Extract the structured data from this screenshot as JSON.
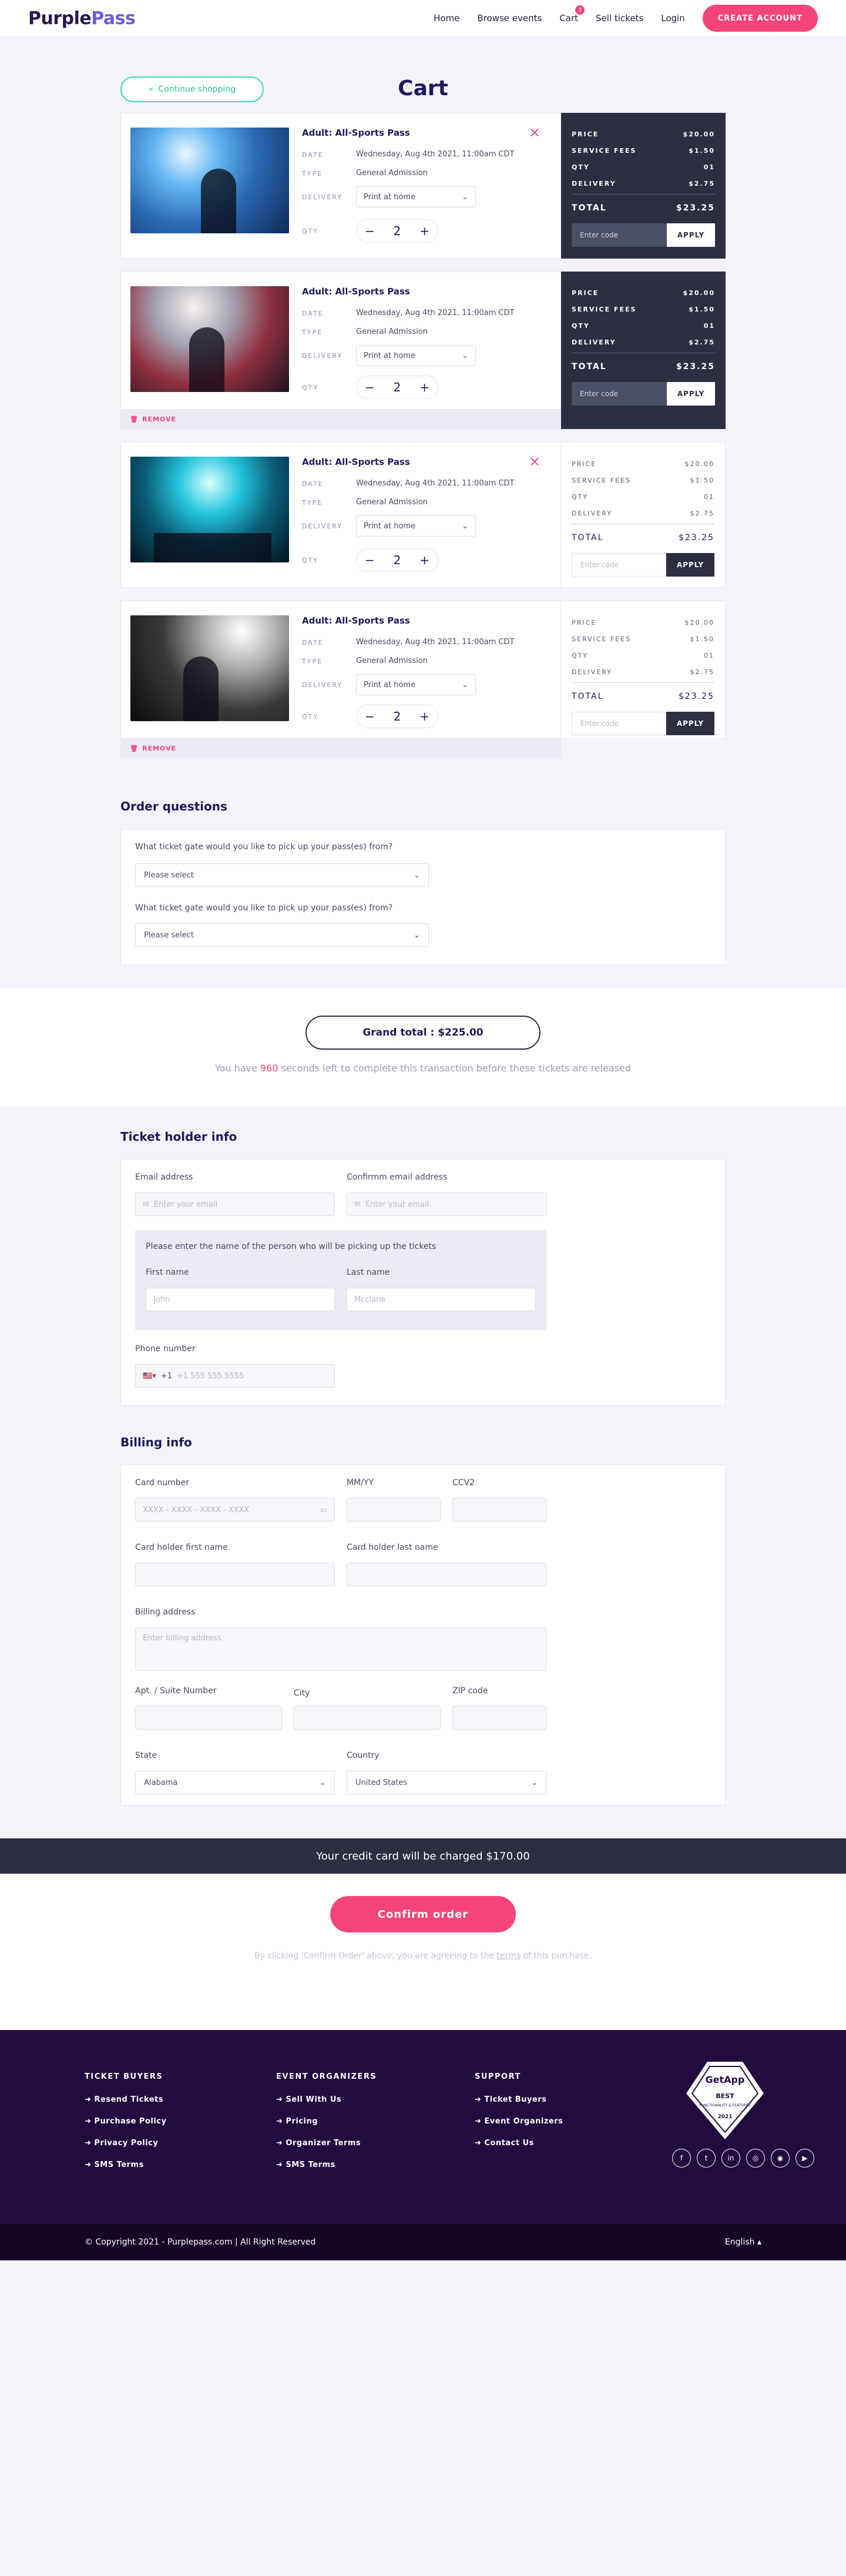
{
  "header": {
    "logo_a": "Purple",
    "logo_b": "Pass",
    "nav": [
      "Home",
      "Browse events",
      "Cart",
      "Sell tickets",
      "Login"
    ],
    "cart_count": "3",
    "create_account": "CREATE ACCOUNT"
  },
  "cart": {
    "continue": "Continue shopping",
    "title": "Cart",
    "labels": {
      "date": "DATE",
      "type": "TYPE",
      "delivery": "DELIVERY",
      "qty": "QTY",
      "remove": "REMOVE"
    },
    "price_labels": {
      "price": "PRICE",
      "fees": "SERVICE FEES",
      "qty": "QTY",
      "delivery": "DELIVERY",
      "total": "TOTAL"
    },
    "promo_placeholder": "Enter code",
    "apply": "APPLY",
    "items": [
      {
        "name": "Adult: All-Sports Pass",
        "date": "Wednesday, Aug 4th 2021, 11:00am CDT",
        "type": "General Admission",
        "delivery": "Print at home",
        "qty": "2",
        "price": "$20.00",
        "fees": "$1.50",
        "pqty": "01",
        "pdelivery": "$2.75",
        "total": "$23.25"
      },
      {
        "name": "Adult: All-Sports Pass",
        "date": "Wednesday, Aug 4th 2021, 11:00am CDT",
        "type": "General Admission",
        "delivery": "Print at home",
        "qty": "2",
        "price": "$20.00",
        "fees": "$1.50",
        "pqty": "01",
        "pdelivery": "$2.75",
        "total": "$23.25"
      },
      {
        "name": "Adult: All-Sports Pass",
        "date": "Wednesday, Aug 4th 2021, 11:00am CDT",
        "type": "General Admission",
        "delivery": "Print at home",
        "qty": "2",
        "price": "$20.00",
        "fees": "$1.50",
        "pqty": "01",
        "pdelivery": "$2.75",
        "total": "$23.25"
      },
      {
        "name": "Adult: All-Sports Pass",
        "date": "Wednesday, Aug 4th 2021, 11:00am CDT",
        "type": "General Admission",
        "delivery": "Print at home",
        "qty": "2",
        "price": "$20.00",
        "fees": "$1.50",
        "pqty": "01",
        "pdelivery": "$2.75",
        "total": "$23.25"
      }
    ]
  },
  "questions": {
    "title": "Order questions",
    "q1": "What ticket gate would you like to pick up your pass(es) from?",
    "q2": "What ticket gate would you like to pick up your pass(es) from?",
    "select_placeholder": "Please select"
  },
  "grand": {
    "label": "Grand total : $225.00",
    "timer_a": "You have ",
    "seconds": "960",
    "timer_b": " seconds left to complete this transaction before these tickets are released"
  },
  "holder": {
    "title": "Ticket holder info",
    "email_label": "Email address",
    "email_ph": "Enter your email",
    "confirm_label": "Confirmm email address",
    "confirm_ph": "Enter your email",
    "pickup_note": "Please enter the name of the person who will be picking up the tickets",
    "first_label": "First name",
    "first_ph": "John",
    "last_label": "Last name",
    "last_ph": "Mcclane",
    "phone_label": "Phone number",
    "phone_code": "+1",
    "phone_ph": "+1 555 555 5555"
  },
  "billing": {
    "title": "Billing info",
    "card_label": "Card number",
    "card_ph": "XXXX - XXXX - XXXX - XXXX",
    "mmyy_label": "MM/YY",
    "ccv_label": "CCV2",
    "cfirst_label": "Card holder first name",
    "clast_label": "Card holder last name",
    "addr_label": "Billing address",
    "addr_ph": "Enter billing address",
    "apt_label": "Apt. / Suite Number",
    "city_label": "City",
    "zip_label": "ZIP code",
    "state_label": "State",
    "state_value": "Alabama",
    "country_label": "Country",
    "country_value": "United States"
  },
  "charge": "Your credit card will be charged $170.00",
  "confirm": {
    "button": "Confirm order",
    "terms_a": "By clicking 'Confirm Order' above, you are agreeing to the ",
    "terms_link": "terms",
    "terms_b": " of this purchase."
  },
  "footer": {
    "col1_title": "TICKET BUYERS",
    "col1": [
      "Resend Tickets",
      "Purchase Policy",
      "Privacy Policy",
      "SMS Terms"
    ],
    "col2_title": "EVENT ORGANIZERS",
    "col2": [
      "Sell With Us",
      "Pricing",
      "Organizer Terms",
      "SMS Terms"
    ],
    "col3_title": "SUPPORT",
    "col3": [
      "Ticket Buyers",
      "Event Organizers",
      "Contact Us"
    ],
    "badge_brand": "GetApp",
    "badge_best": "BEST",
    "badge_line": "FUNCTIONALITY & FEATURES",
    "badge_year": "2021",
    "copyright": "© Copyright 2021 - Purplepass.com | All Right Reserved",
    "language": "English"
  },
  "colors": {
    "accent": "#f3457b",
    "dark_panel": "#2b2f40",
    "teal": "#3dd6b2",
    "footer": "#210b3f"
  }
}
